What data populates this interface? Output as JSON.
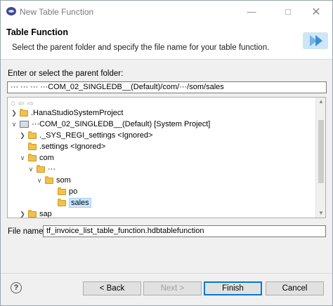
{
  "window": {
    "title": "New Table Function"
  },
  "header": {
    "title": "Table Function",
    "description": "Select the parent folder and specify the file name for your table function."
  },
  "parent_folder": {
    "label": "Enter or select the parent folder:",
    "value": "··· ··· ··· ···COM_02_SINGLEDB__(Default)/com/···/som/sales"
  },
  "tree": {
    "items": [
      {
        "label": ".HanaStudioSystemProject",
        "expanded": false,
        "depth": 0,
        "icon": "folder-icon"
      },
      {
        "label": "···COM_02_SINGLEDB__(Default) [System Project]",
        "expanded": true,
        "depth": 0,
        "icon": "project-icon"
      },
      {
        "label": "._SYS_REGI_settings <Ignored>",
        "expanded": false,
        "depth": 1,
        "icon": "folder-icon"
      },
      {
        "label": ".settings <Ignored>",
        "expanded": null,
        "depth": 1,
        "icon": "folder-icon"
      },
      {
        "label": "com",
        "expanded": true,
        "depth": 1,
        "icon": "folder-icon"
      },
      {
        "label": "···",
        "expanded": true,
        "depth": 2,
        "icon": "folder-icon"
      },
      {
        "label": "som",
        "expanded": true,
        "depth": 3,
        "icon": "folder-icon"
      },
      {
        "label": "po",
        "expanded": null,
        "depth": 4,
        "icon": "folder-icon"
      },
      {
        "label": "sales",
        "expanded": null,
        "depth": 4,
        "icon": "folder-icon",
        "selected": true
      },
      {
        "label": "sap",
        "expanded": false,
        "depth": 1,
        "icon": "folder-icon"
      }
    ]
  },
  "file_name": {
    "label": "File name:",
    "value": "tf_invoice_list_table_function.hdbtablefunction"
  },
  "buttons": {
    "back": "< Back",
    "next": "Next >",
    "finish": "Finish",
    "cancel": "Cancel"
  },
  "colors": {
    "selection": "#cce8ff",
    "default_button_border": "#0078d7",
    "folder": "#f2c14e"
  }
}
